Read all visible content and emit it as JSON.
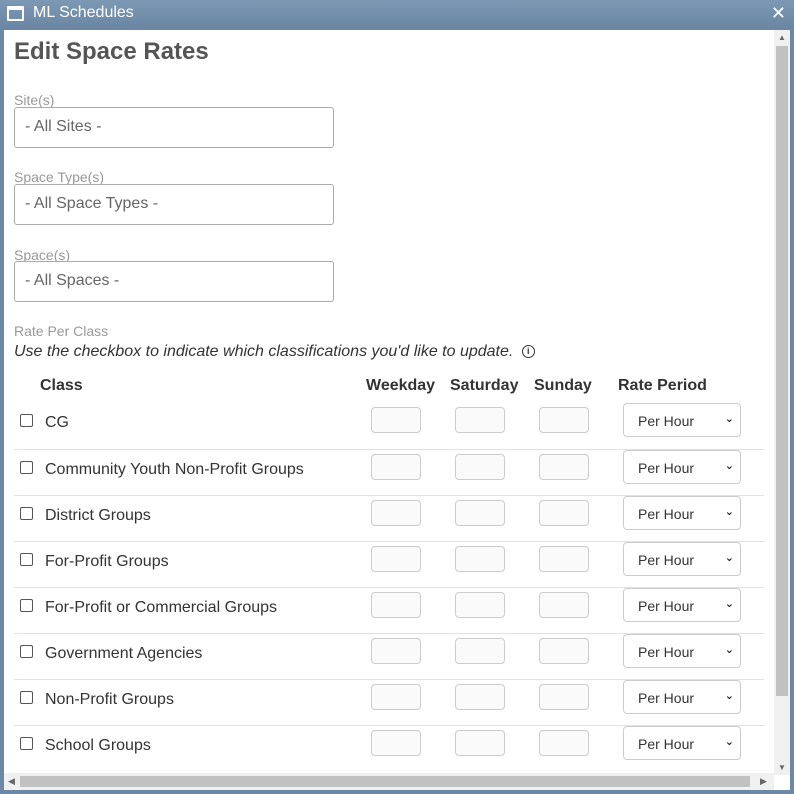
{
  "window": {
    "title": "ML Schedules",
    "close_label": "✕"
  },
  "page": {
    "title": "Edit Space Rates"
  },
  "filters": {
    "sites": {
      "label": "Site(s)",
      "value": "- All Sites -"
    },
    "space_types": {
      "label": "Space Type(s)",
      "value": "- All Space Types -"
    },
    "spaces": {
      "label": "Space(s)",
      "value": "- All Spaces -"
    }
  },
  "rates": {
    "label": "Rate Per Class",
    "hint": "Use the checkbox to indicate which classifications you'd like to update.",
    "info_glyph": "i",
    "columns": {
      "class": "Class",
      "weekday": "Weekday",
      "saturday": "Saturday",
      "sunday": "Sunday",
      "rate_period": "Rate Period"
    },
    "rows": [
      {
        "class": "CG",
        "weekday": "",
        "saturday": "",
        "sunday": "",
        "period": "Per Hour"
      },
      {
        "class": "Community Youth Non-Profit Groups",
        "weekday": "",
        "saturday": "",
        "sunday": "",
        "period": "Per Hour"
      },
      {
        "class": "District Groups",
        "weekday": "",
        "saturday": "",
        "sunday": "",
        "period": "Per Hour"
      },
      {
        "class": "For-Profit Groups",
        "weekday": "",
        "saturday": "",
        "sunday": "",
        "period": "Per Hour"
      },
      {
        "class": "For-Profit or Commercial Groups",
        "weekday": "",
        "saturday": "",
        "sunday": "",
        "period": "Per Hour"
      },
      {
        "class": "Government Agencies",
        "weekday": "",
        "saturday": "",
        "sunday": "",
        "period": "Per Hour"
      },
      {
        "class": "Non-Profit Groups",
        "weekday": "",
        "saturday": "",
        "sunday": "",
        "period": "Per Hour"
      },
      {
        "class": "School Groups",
        "weekday": "",
        "saturday": "",
        "sunday": "",
        "period": "Per Hour"
      }
    ]
  },
  "icons": {
    "chevron": "chevron-down-icon",
    "window": "window-icon",
    "password_manager": "password-manager-icon"
  }
}
